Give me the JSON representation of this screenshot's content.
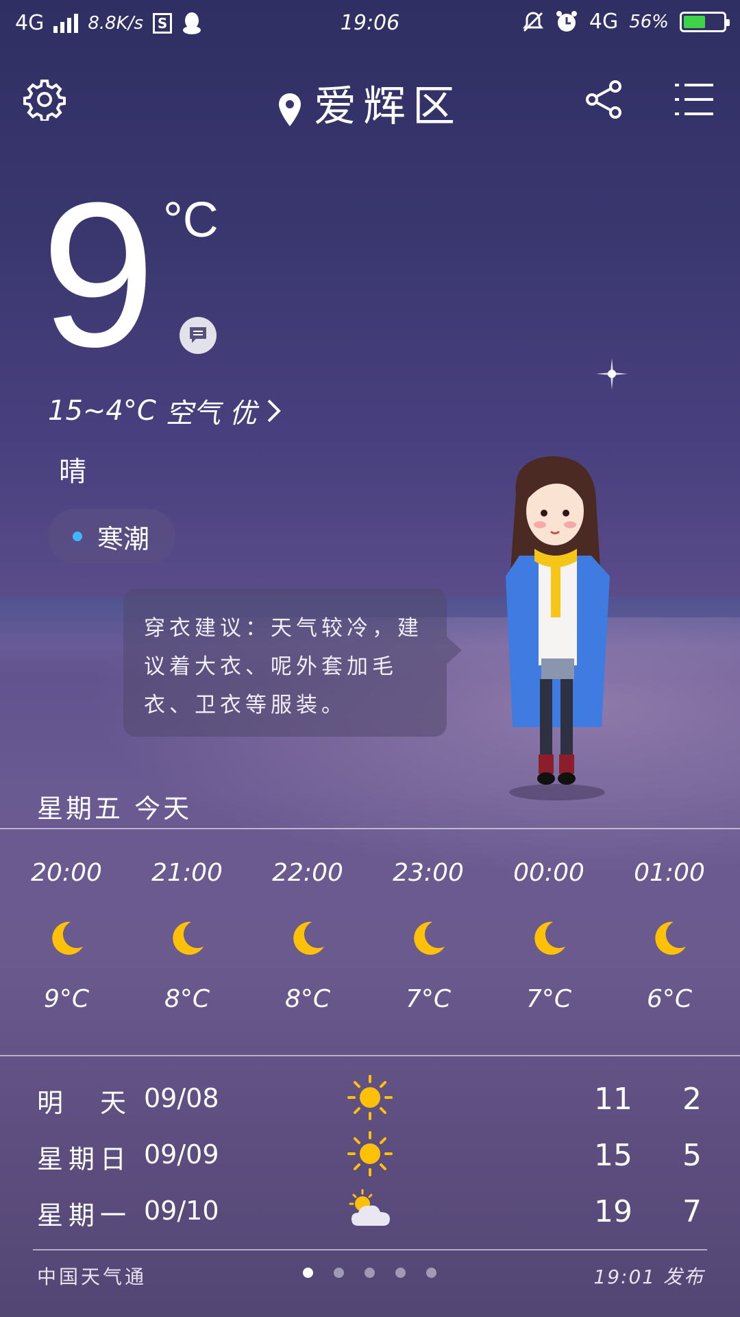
{
  "status_bar": {
    "network": "4G",
    "speed": "8.8K/s",
    "s_badge": "S",
    "time": "19:06",
    "network_right": "4G",
    "battery": "56%",
    "battery_level": 0.56
  },
  "header": {
    "city": "爱辉区",
    "icons": [
      "gear-icon",
      "location-pin-icon",
      "share-icon",
      "menu-icon"
    ]
  },
  "current": {
    "temperature": "9",
    "unit": "°C",
    "range": "15~4°C",
    "air_quality": "空气 优",
    "condition": "晴",
    "alert": "寒潮",
    "advice": "穿衣建议：天气较冷，建议着大衣、呢外套加毛衣、卫衣等服装。"
  },
  "today": {
    "label": "星期五  今天",
    "hours": [
      {
        "time": "20:00",
        "icon": "moon-icon",
        "temp": "9°C"
      },
      {
        "time": "21:00",
        "icon": "moon-icon",
        "temp": "8°C"
      },
      {
        "time": "22:00",
        "icon": "moon-icon",
        "temp": "8°C"
      },
      {
        "time": "23:00",
        "icon": "moon-icon",
        "temp": "7°C"
      },
      {
        "time": "00:00",
        "icon": "moon-icon",
        "temp": "7°C"
      },
      {
        "time": "01:00",
        "icon": "moon-icon",
        "temp": "6°C"
      }
    ]
  },
  "forecast": [
    {
      "day": "明　天",
      "date": "09/08",
      "icon": "sun-icon",
      "high": "11",
      "low": "2"
    },
    {
      "day": "星期日",
      "date": "09/09",
      "icon": "sun-icon",
      "high": "15",
      "low": "5"
    },
    {
      "day": "星期一",
      "date": "09/10",
      "icon": "partly-cloudy-icon",
      "high": "19",
      "low": "7"
    }
  ],
  "footer": {
    "source": "中国天气通",
    "published": "19:01 发布",
    "page_count": 5,
    "active_page": 0
  },
  "colors": {
    "moon": "#ffc107",
    "sun": "#ffc107",
    "alert_dot": "#3fb7ff",
    "battery_fill": "#3fd34a"
  }
}
